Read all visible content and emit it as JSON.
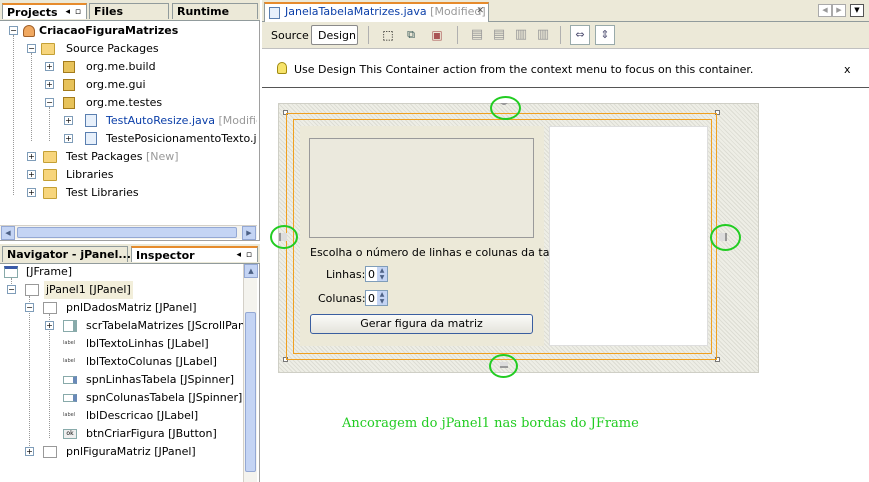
{
  "projects_panel": {
    "tabs": [
      "Projects",
      "Files",
      "Runtime"
    ],
    "tab_close_glyph": "◂◻",
    "tree": [
      {
        "label": "CriacaoFiguraMatrizes",
        "icon": "project-icon"
      },
      {
        "label": "Source Packages",
        "icon": "source-folder-icon"
      },
      {
        "label": "org.me.build",
        "icon": "package-icon"
      },
      {
        "label": "org.me.gui",
        "icon": "package-icon"
      },
      {
        "label": "org.me.testes",
        "icon": "package-icon"
      },
      {
        "label": "TestAutoResize.java",
        "suffix": "[Modified]",
        "icon": "java-file-icon"
      },
      {
        "label": "TestePosicionamentoTexto.java",
        "icon": "java-file-icon"
      },
      {
        "label": "Test Packages",
        "suffix": "[New]",
        "icon": "folder-icon"
      },
      {
        "label": "Libraries",
        "icon": "folder-icon"
      },
      {
        "label": "Test Libraries",
        "icon": "folder-icon"
      }
    ]
  },
  "navigator_panel": {
    "tabs": [
      "Navigator - jPanel...",
      "Inspector"
    ],
    "tab_close_glyph": "◂◻",
    "tree": [
      {
        "label": "[JFrame]"
      },
      {
        "label": "jPanel1 [JPanel]"
      },
      {
        "label": "pnlDadosMatriz [JPanel]"
      },
      {
        "label": "scrTabelaMatrizes [JScrollPane]"
      },
      {
        "label": "lblTextoLinhas [JLabel]"
      },
      {
        "label": "lblTextoColunas [JLabel]"
      },
      {
        "label": "spnLinhasTabela [JSpinner]"
      },
      {
        "label": "spnColunasTabela [JSpinner]"
      },
      {
        "label": "lblDescricao [JLabel]"
      },
      {
        "label": "btnCriarFigura [JButton]"
      },
      {
        "label": "pnlFiguraMatriz [JPanel]"
      }
    ]
  },
  "editor": {
    "tab_title": "JanelaTabelaMatrizes.java",
    "tab_modified": "[Modified]",
    "tab_close": "✕",
    "views": [
      "Source",
      "Design"
    ],
    "hint": "Use Design This Container action from the context menu to focus on this container.",
    "hint_close": "x"
  },
  "form": {
    "description": "Escolha o número de linhas e colunas da tabela",
    "rows_label": "Linhas:",
    "rows_value": "0",
    "cols_label": "Colunas:",
    "cols_value": "0",
    "button": "Gerar figura da matriz"
  },
  "annotation": "Ancoragem do jPanel1 nas bordas do JFrame",
  "colors": {
    "anchor_ring": "#22cc22",
    "selection": "#f0a020",
    "annotation": "#22cc22",
    "tab_accent": "#e68b2c"
  }
}
